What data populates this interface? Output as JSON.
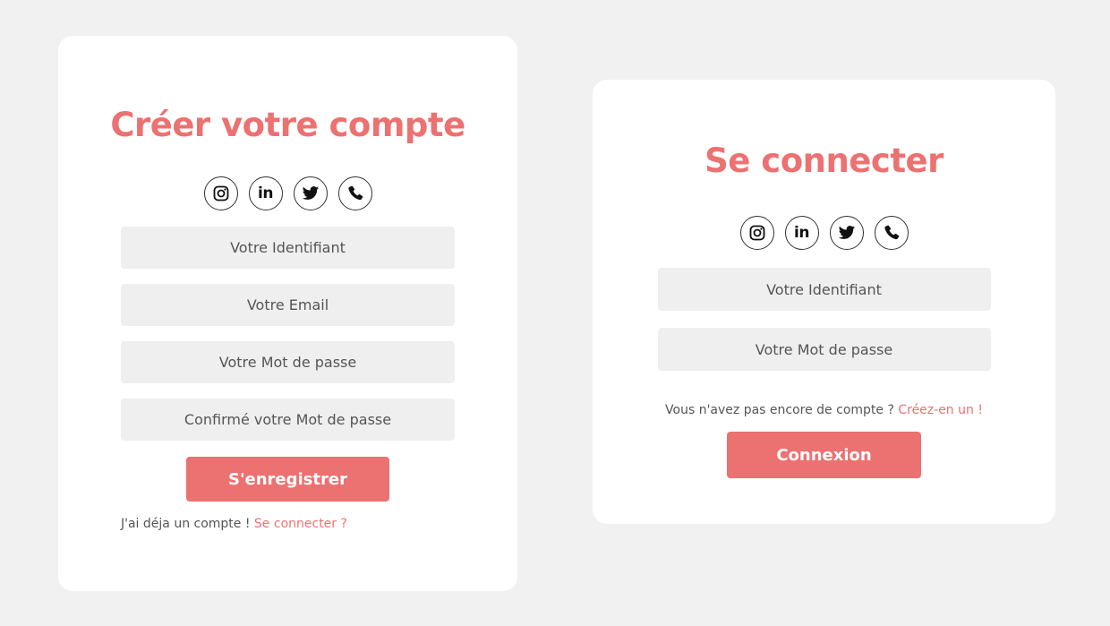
{
  "colors": {
    "accent": "#ec7171",
    "background": "#f1f1f1",
    "card": "#ffffff",
    "field": "#efefef"
  },
  "register": {
    "title": "Créer votre compte",
    "socials": [
      "instagram-icon",
      "linkedin-icon",
      "twitter-icon",
      "phone-icon"
    ],
    "linkedin_text": "in",
    "username_placeholder": "Votre Identifiant",
    "email_placeholder": "Votre Email",
    "password_placeholder": "Votre Mot de passe",
    "confirm_placeholder": "Confirmé votre Mot de passe",
    "submit_label": "S'enregistrer",
    "footer_text": "J'ai déja un compte ! ",
    "footer_link": "Se connecter ?"
  },
  "login": {
    "title": "Se connecter",
    "socials": [
      "instagram-icon",
      "linkedin-icon",
      "twitter-icon",
      "phone-icon"
    ],
    "linkedin_text": "in",
    "username_placeholder": "Votre Identifiant",
    "password_placeholder": "Votre Mot de passe",
    "footer_text": "Vous n'avez pas encore de compte ? ",
    "footer_link": "Créez-en un !",
    "submit_label": "Connexion"
  }
}
